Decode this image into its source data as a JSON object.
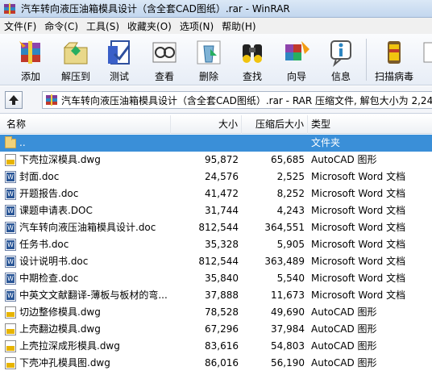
{
  "window": {
    "title": "汽车转向液压油箱模具设计（含全套CAD图纸）.rar - WinRAR"
  },
  "menu": [
    "文件(F)",
    "命令(C)",
    "工具(S)",
    "收藏夹(O)",
    "选项(N)",
    "帮助(H)"
  ],
  "toolbar": [
    {
      "label": "添加",
      "icon": "add-archive-icon"
    },
    {
      "label": "解压到",
      "icon": "extract-to-icon"
    },
    {
      "label": "测试",
      "icon": "test-icon"
    },
    {
      "label": "查看",
      "icon": "view-icon"
    },
    {
      "label": "删除",
      "icon": "delete-icon"
    },
    {
      "label": "查找",
      "icon": "find-icon"
    },
    {
      "label": "向导",
      "icon": "wizard-icon"
    },
    {
      "label": "信息",
      "icon": "info-icon"
    },
    {
      "label": "扫描病毒",
      "icon": "virus-scan-icon"
    }
  ],
  "address": {
    "path": "汽车转向液压油箱模具设计（含全套CAD图纸）.rar - RAR 压缩文件, 解包大小为 2,24"
  },
  "columns": {
    "name": "名称",
    "size": "大小",
    "packed": "压缩后大小",
    "type": "类型"
  },
  "files": [
    {
      "name": "..",
      "size": "",
      "packed": "",
      "type": "文件夹",
      "kind": "folder",
      "selected": true
    },
    {
      "name": "下壳拉深模具.dwg",
      "size": "95,872",
      "packed": "65,685",
      "type": "AutoCAD 图形",
      "kind": "dwg"
    },
    {
      "name": "封面.doc",
      "size": "24,576",
      "packed": "2,525",
      "type": "Microsoft Word 文档",
      "kind": "doc"
    },
    {
      "name": "开题报告.doc",
      "size": "41,472",
      "packed": "8,252",
      "type": "Microsoft Word 文档",
      "kind": "doc"
    },
    {
      "name": "课题申请表.DOC",
      "size": "31,744",
      "packed": "4,243",
      "type": "Microsoft Word 文档",
      "kind": "doc"
    },
    {
      "name": "汽车转向液压油箱模具设计.doc",
      "size": "812,544",
      "packed": "364,551",
      "type": "Microsoft Word 文档",
      "kind": "doc"
    },
    {
      "name": "任务书.doc",
      "size": "35,328",
      "packed": "5,905",
      "type": "Microsoft Word 文档",
      "kind": "doc"
    },
    {
      "name": "设计说明书.doc",
      "size": "812,544",
      "packed": "363,489",
      "type": "Microsoft Word 文档",
      "kind": "doc"
    },
    {
      "name": "中期检查.doc",
      "size": "35,840",
      "packed": "5,540",
      "type": "Microsoft Word 文档",
      "kind": "doc"
    },
    {
      "name": "中英文文献翻译-薄板与板材的弯...",
      "size": "37,888",
      "packed": "11,673",
      "type": "Microsoft Word 文档",
      "kind": "doc"
    },
    {
      "name": "切边整修模具.dwg",
      "size": "78,528",
      "packed": "49,690",
      "type": "AutoCAD 图形",
      "kind": "dwg"
    },
    {
      "name": "上壳翻边模具.dwg",
      "size": "67,296",
      "packed": "37,984",
      "type": "AutoCAD 图形",
      "kind": "dwg"
    },
    {
      "name": "上壳拉深成形模具.dwg",
      "size": "83,616",
      "packed": "54,803",
      "type": "AutoCAD 图形",
      "kind": "dwg"
    },
    {
      "name": "下壳冲孔模具图.dwg",
      "size": "86,016",
      "packed": "56,190",
      "type": "AutoCAD 图形",
      "kind": "dwg"
    }
  ]
}
